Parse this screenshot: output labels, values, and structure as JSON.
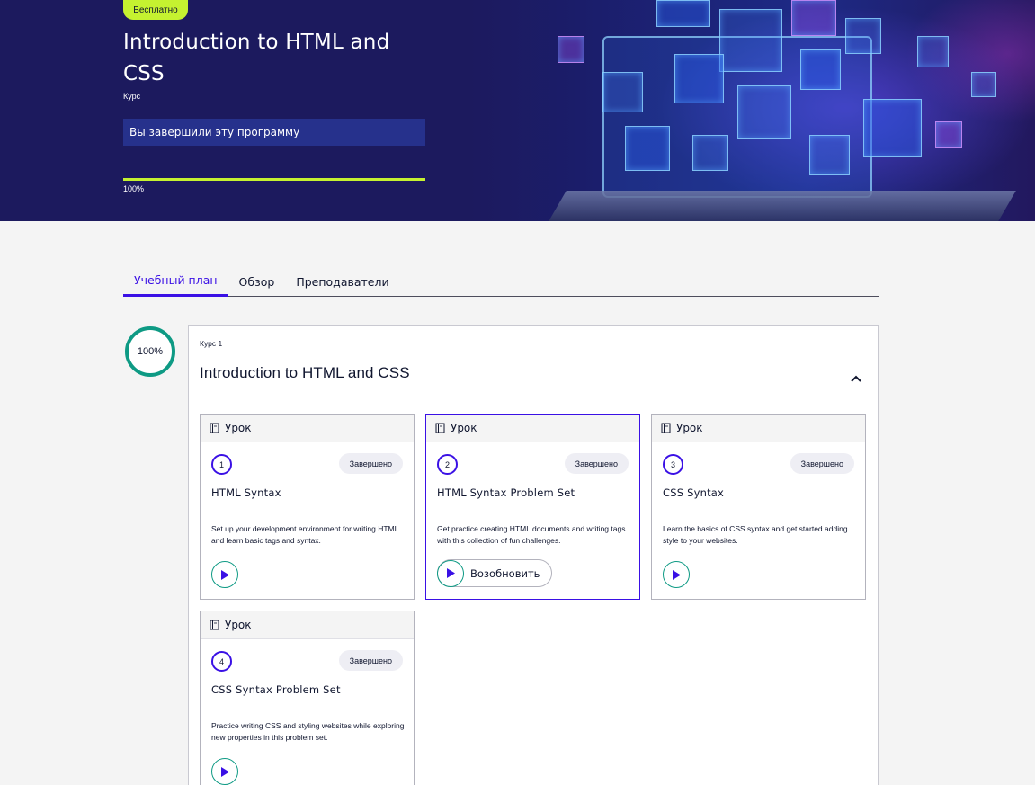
{
  "hero": {
    "badge": "Бесплатно",
    "title": "Introduction to HTML and CSS",
    "kind": "Курс",
    "status": "Вы завершили эту программу",
    "progress_value": 100,
    "progress_label": "100%"
  },
  "tabs": [
    {
      "label": "Учебный план",
      "active": true
    },
    {
      "label": "Обзор",
      "active": false
    },
    {
      "label": "Преподаватели",
      "active": false
    }
  ],
  "course": {
    "progress_label": "100%",
    "kind": "Курс 1",
    "title": "Introduction to HTML and CSS",
    "lessons": [
      {
        "type": "Урок",
        "number": "1",
        "status": "Завершено",
        "title": "HTML Syntax",
        "description": "Set up your development environment for writing HTML and learn basic tags and syntax."
      },
      {
        "type": "Урок",
        "number": "2",
        "status": "Завершено",
        "title": "HTML Syntax Problem Set",
        "description": "Get practice creating HTML documents and writing tags with this collection of fun challenges.",
        "action": "Возобновить"
      },
      {
        "type": "Урок",
        "number": "3",
        "status": "Завершено",
        "title": "CSS Syntax",
        "description": "Learn the basics of CSS syntax and get started adding style to your websites."
      },
      {
        "type": "Урок",
        "number": "4",
        "status": "Завершено",
        "title": "CSS Syntax Problem Set",
        "description": "Practice writing CSS and styling websites while exploring new properties in this problem set."
      }
    ]
  },
  "colors": {
    "hero_bg": "#1c1a5e",
    "accent_lime": "#c5f230",
    "accent_blue": "#3a10e5",
    "accent_teal": "#0e9a84"
  },
  "icons": {
    "lesson": "book-icon",
    "play": "play-icon",
    "collapse": "chevron-up-icon"
  }
}
